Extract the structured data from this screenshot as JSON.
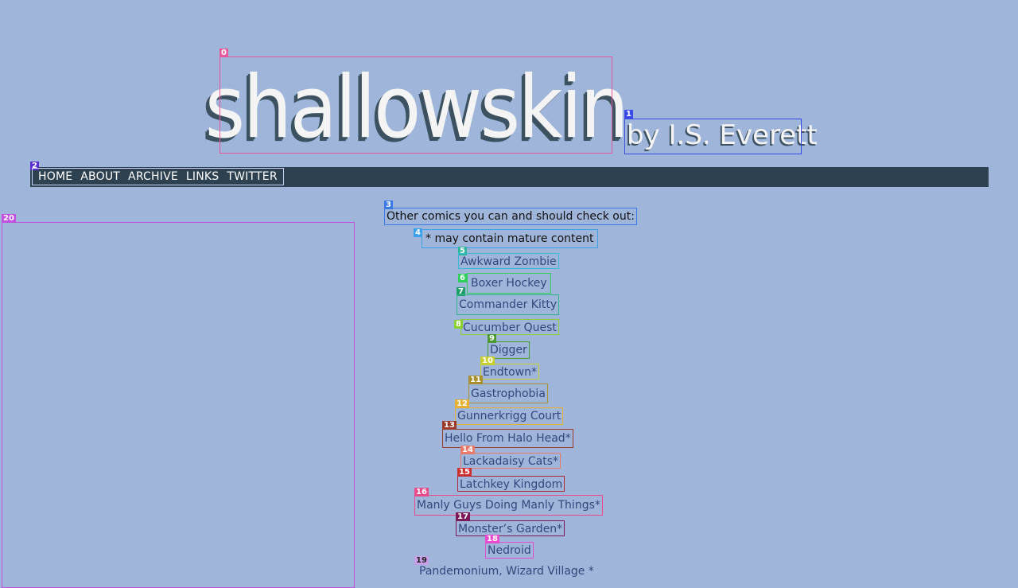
{
  "header": {
    "logo_text": "shallowskin",
    "byline": "by I.S. Everett"
  },
  "nav": {
    "items": [
      {
        "label": "HOME"
      },
      {
        "label": "ABOUT"
      },
      {
        "label": "ARCHIVE"
      },
      {
        "label": "LINKS"
      },
      {
        "label": "TWITTER"
      }
    ]
  },
  "main": {
    "heading": "Other comics you can and should check out:",
    "note": "* may contain mature content",
    "links": [
      {
        "label": "Awkward Zombie"
      },
      {
        "label": "Boxer Hockey"
      },
      {
        "label": "Commander Kitty"
      },
      {
        "label": "Cucumber Quest"
      },
      {
        "label": "Digger"
      },
      {
        "label": "Endtown*"
      },
      {
        "label": "Gastrophobia"
      },
      {
        "label": "Gunnerkrigg Court"
      },
      {
        "label": "Hello From Halo Head*"
      },
      {
        "label": "Lackadaisy Cats*"
      },
      {
        "label": "Latchkey Kingdom"
      },
      {
        "label": "Manly Guys Doing Manly Things*"
      },
      {
        "label": "Monster’s Garden*"
      },
      {
        "label": "Nedroid"
      },
      {
        "label": "Pandemonium, Wizard Village *"
      }
    ]
  },
  "badges": [
    "0",
    "1",
    "2",
    "3",
    "4",
    "5",
    "6",
    "7",
    "8",
    "9",
    "10",
    "11",
    "12",
    "13",
    "14",
    "15",
    "16",
    "17",
    "18",
    "19",
    "20"
  ],
  "colors": {
    "background": "#9fb5d9",
    "navbar": "#2d4150",
    "link": "#34477e"
  }
}
